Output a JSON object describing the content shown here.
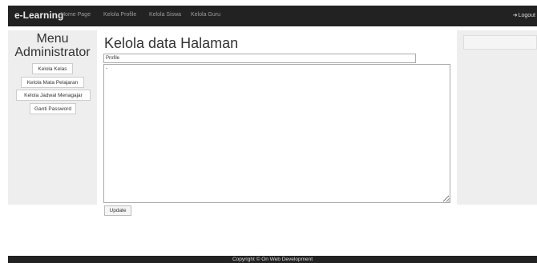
{
  "navbar": {
    "brand": "e-Learning",
    "items": [
      {
        "label": "Home Page"
      },
      {
        "label": "Kelola Profile"
      },
      {
        "label": "Kelola Siswa"
      },
      {
        "label": "Kelola Guru"
      }
    ],
    "logout_label": "Logout",
    "logout_icon": "logout-icon"
  },
  "sidebar": {
    "title_line1": "Menu",
    "title_line2": "Administrator",
    "items": [
      {
        "label": "Kelola Kelas"
      },
      {
        "label": "Kelola Mata Pelajaran"
      },
      {
        "label": "Kelola Jadwal Menagajar"
      },
      {
        "label": "Ganti Password"
      }
    ]
  },
  "main": {
    "title": "Kelola data Halaman",
    "title_field_value": "Profile",
    "content_value": "-",
    "update_label": "Update"
  },
  "footer": {
    "text": "Copyright © On Web Development"
  },
  "colors": {
    "navbar_bg": "#222222",
    "panel_bg": "#eeeeee"
  }
}
